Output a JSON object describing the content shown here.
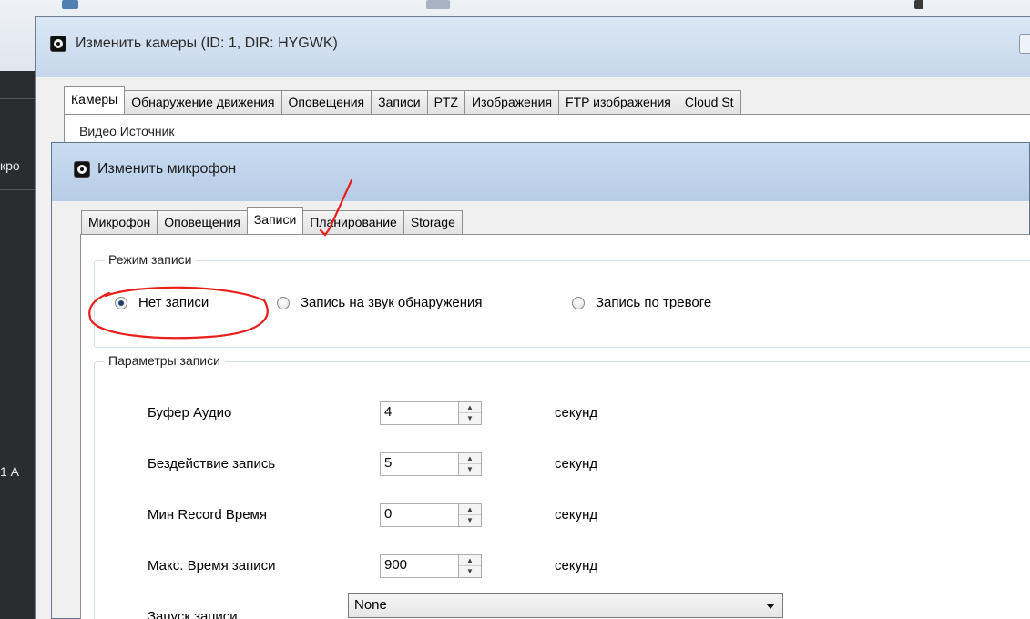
{
  "background": {
    "side_text_1": "кро",
    "side_text_2": "1 А"
  },
  "camera_window": {
    "title": "Изменить камеры (ID: 1, DIR: HYGWK)",
    "tabs": [
      {
        "label": "Камеры",
        "active": true
      },
      {
        "label": "Обнаружение движения"
      },
      {
        "label": "Оповещения"
      },
      {
        "label": "Записи"
      },
      {
        "label": "PTZ"
      },
      {
        "label": "Изображения"
      },
      {
        "label": "FTP изображения"
      },
      {
        "label": "Cloud St"
      }
    ],
    "group_label": "Видео Источник"
  },
  "mic_window": {
    "title": "Изменить микрофон",
    "tabs": [
      {
        "label": "Микрофон"
      },
      {
        "label": "Оповещения"
      },
      {
        "label": "Записи",
        "active": true
      },
      {
        "label": "Планирование"
      },
      {
        "label": "Storage"
      }
    ],
    "record_mode": {
      "legend": "Режим записи",
      "options": [
        {
          "label": "Нет записи",
          "checked": true
        },
        {
          "label": "Запись на звук обнаружения",
          "checked": false
        },
        {
          "label": "Запись по тревоге",
          "checked": false
        }
      ]
    },
    "params": {
      "legend": "Параметры записи",
      "rows": [
        {
          "label": "Буфер Аудио",
          "value": "4",
          "unit": "секунд"
        },
        {
          "label": "Бездействие запись",
          "value": "5",
          "unit": "секунд"
        },
        {
          "label": "Мин Record Время",
          "value": "0",
          "unit": "секунд"
        },
        {
          "label": "Макс. Время записи",
          "value": "900",
          "unit": "секунд"
        }
      ],
      "start_label": "Запуск записи",
      "start_value": "None"
    }
  },
  "colors": {
    "annotation_red": "#e8201c",
    "titlebar_blue": "#c6d7ec",
    "radio_checked": "#1f3f6a"
  },
  "icons": {
    "window_icon": "eye-icon",
    "spin_icon": "spinner-arrows-icon",
    "dropdown_icon": "chevron-down-icon"
  }
}
